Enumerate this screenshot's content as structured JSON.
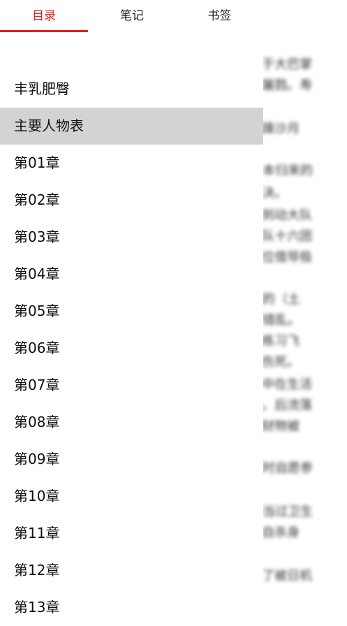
{
  "tabs": [
    {
      "label": "目录",
      "active": true
    },
    {
      "label": "笔记",
      "active": false
    },
    {
      "label": "书签",
      "active": false
    }
  ],
  "accent_color": "#e02020",
  "toc": {
    "selected_index": 1,
    "items": [
      "丰乳肥臀",
      "主要人物表",
      "第01章",
      "第02章",
      "第03章",
      "第04章",
      "第05章",
      "第06章",
      "第07章",
      "第08章",
      "第09章",
      "第10章",
      "第11章",
      "第12章",
      "第13章"
    ]
  },
  "reader_background_lines": [
    "上官福禄：上官寿喜之父，上官吕氏之夫。与其父于大巴掌",
    "共同经营铁匠铺。因日本人入侵，与其子同遭屠戮。寿",
    "喜之死...先...躁沙月",
    "从日本归来的",
    "...处决。",
    "...日到动大队",
    "...纵队十六团",
    "...部位借导极",
    "小鸭的（土",
    "...神经错乱。",
    "...因练习飞",
    "...摔伤死。",
    "...部中在生活",
    "...院。后流落",
    "...的财物被",
    "...少年时自愿参",
    "...曾经当过卫生",
    "...中自杀身",
    "...上了被日机"
  ]
}
